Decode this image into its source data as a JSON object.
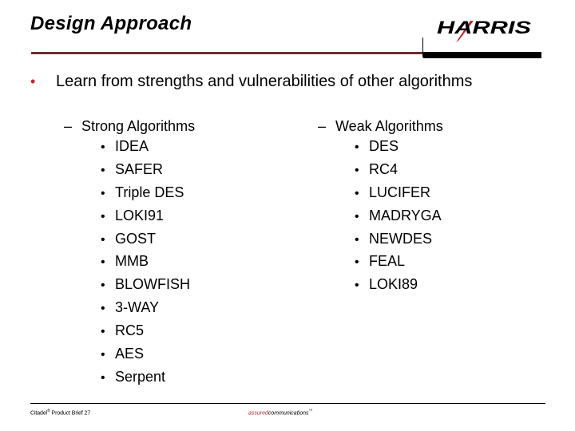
{
  "header": {
    "title": "Design Approach",
    "logo_text": "HARRIS",
    "logo_colors": {
      "text": "#000000",
      "swoosh": "#c0272d"
    },
    "rule_color": "#6e2a30"
  },
  "main_bullet": {
    "text": "Learn from strengths and vulnerabilities of other algorithms",
    "bullet_color": "#c0272d"
  },
  "columns": [
    {
      "heading": "Strong Algorithms",
      "items": [
        "IDEA",
        "SAFER",
        "Triple DES",
        "LOKI91",
        "GOST",
        "MMB",
        "BLOWFISH",
        "3-WAY",
        "RC5",
        "AES",
        "Serpent"
      ]
    },
    {
      "heading": "Weak Algorithms",
      "items": [
        "DES",
        "RC4",
        "LUCIFER",
        "MADRYGA",
        "NEWDES",
        "FEAL",
        "LOKI89"
      ]
    }
  ],
  "footer": {
    "left_brand": "Citadel",
    "left_mark": "®",
    "left_rest": " Product Brief 27",
    "tagline_part1": "assured",
    "tagline_part2": "communications",
    "tagline_mark": "™"
  },
  "glyphs": {
    "dash": "–",
    "bullet": "•"
  }
}
